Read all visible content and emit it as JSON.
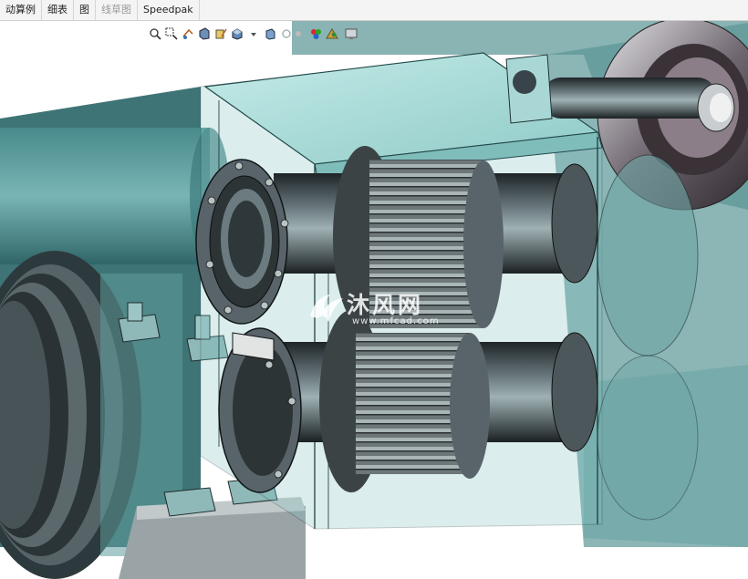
{
  "tabs": [
    {
      "label": "动算例"
    },
    {
      "label": "细表"
    },
    {
      "label": "图"
    },
    {
      "label": "线草图"
    },
    {
      "label": "Speedpak"
    }
  ],
  "heads_up_toolbar": {
    "icons": [
      "zoom-to-fit-icon",
      "zoom-area-icon",
      "previous-view-icon",
      "section-view-icon",
      "dynamic-annotation-icon",
      "view-orientation-icon",
      "display-style-icon",
      "hide-show-icon",
      "edit-appearance-icon",
      "apply-scene-icon",
      "view-settings-icon"
    ]
  },
  "watermark": {
    "brand": "沐风网",
    "site": "www.mfcad.com"
  },
  "colors": {
    "housing_teal": "#5f9ea0",
    "cover_top": "#a9d8d6",
    "shaft_dark": "#2f3a3e",
    "tab_bg": "#f4f4f4"
  }
}
